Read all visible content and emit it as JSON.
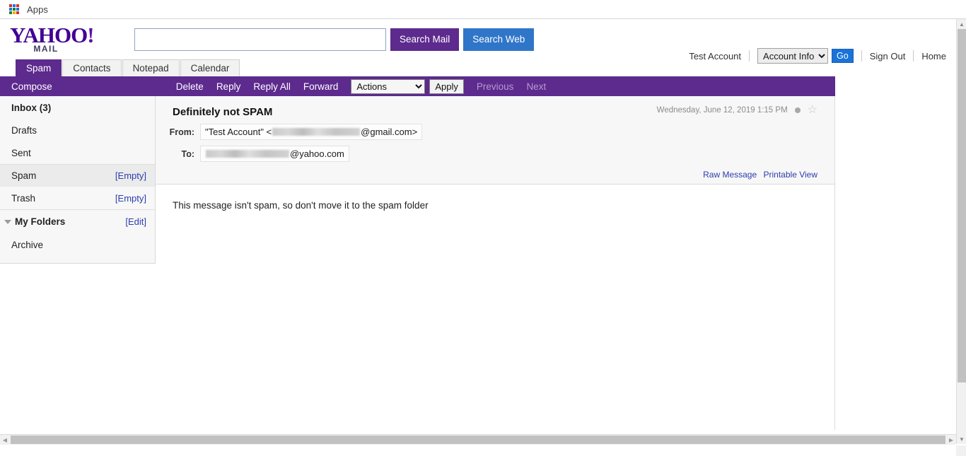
{
  "browser": {
    "apps_label": "Apps",
    "apps_icon": "grid-apps-icon",
    "apps_colors": [
      "#d93025",
      "#1a73e8",
      "#d93025",
      "#1a73e8",
      "#188038",
      "#1a73e8",
      "#188038",
      "#f9ab00",
      "#d93025"
    ]
  },
  "header": {
    "logo_word": "YAHOO",
    "logo_excl": "!",
    "logo_sub": "MAIL",
    "search": {
      "value": "",
      "placeholder": "",
      "search_mail_label": "Search Mail",
      "search_web_label": "Search Web"
    },
    "account_name": "Test Account",
    "account_select_value": "Account Info",
    "account_select_options": [
      "Account Info"
    ],
    "go_label": "Go",
    "sign_out_label": "Sign Out",
    "home_label": "Home"
  },
  "tabs": [
    {
      "label": "Spam",
      "active": true
    },
    {
      "label": "Contacts",
      "active": false
    },
    {
      "label": "Notepad",
      "active": false
    },
    {
      "label": "Calendar",
      "active": false
    }
  ],
  "toolbar": {
    "compose_label": "Compose",
    "delete_label": "Delete",
    "reply_label": "Reply",
    "reply_all_label": "Reply All",
    "forward_label": "Forward",
    "actions_value": "Actions",
    "actions_options": [
      "Actions"
    ],
    "apply_label": "Apply",
    "previous_label": "Previous",
    "next_label": "Next"
  },
  "sidebar": {
    "folders": [
      {
        "label": "Inbox (3)",
        "action": "",
        "bold": true,
        "selected": false
      },
      {
        "label": "Drafts",
        "action": "",
        "bold": false,
        "selected": false
      },
      {
        "label": "Sent",
        "action": "",
        "bold": false,
        "selected": false
      },
      {
        "label": "Spam",
        "action": "[Empty]",
        "bold": false,
        "selected": true
      },
      {
        "label": "Trash",
        "action": "[Empty]",
        "bold": false,
        "selected": false
      }
    ],
    "my_folders_label": "My Folders",
    "edit_label": "[Edit]",
    "subfolders": [
      {
        "label": "Archive"
      }
    ]
  },
  "message": {
    "subject": "Definitely not SPAM",
    "date": "Wednesday, June 12, 2019 1:15 PM",
    "read_dot_icon": "read-status-dot-icon",
    "star_icon": "star-outline-icon",
    "from_label": "From:",
    "from_prefix": "\"Test Account\" <",
    "from_suffix": "@gmail.com>",
    "to_label": "To:",
    "to_prefix": "",
    "to_suffix": "@yahoo.com",
    "raw_message_label": "Raw Message",
    "printable_view_label": "Printable View",
    "body": "This message isn't spam, so don't move it to the spam folder"
  },
  "scrollbars": {
    "up_arrow": "▲",
    "down_arrow": "▼",
    "left_arrow": "◀",
    "right_arrow": "▶"
  },
  "colors": {
    "brand_purple": "#5d2a8e",
    "link_blue": "#2b3dad",
    "web_blue": "#2f76c9",
    "go_blue": "#1a73d9"
  }
}
